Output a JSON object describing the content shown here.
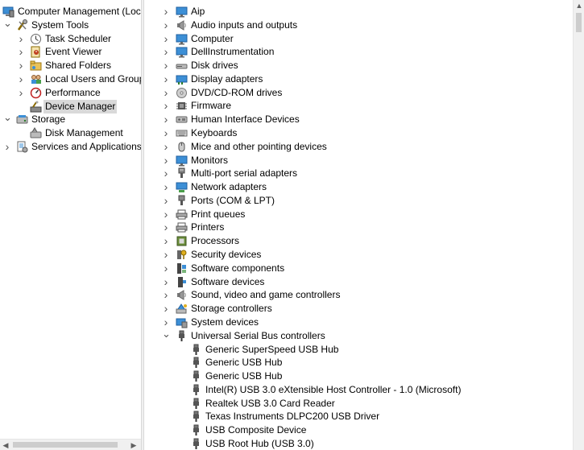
{
  "console_tree": {
    "items": [
      {
        "label": "Computer Management (Local",
        "icon": "computer-management-icon",
        "level": 0,
        "expander": ""
      },
      {
        "label": "System Tools",
        "icon": "system-tools-icon",
        "level": 1,
        "expander": "expanded"
      },
      {
        "label": "Task Scheduler",
        "icon": "clock-icon",
        "level": 2,
        "expander": "collapsed"
      },
      {
        "label": "Event Viewer",
        "icon": "event-viewer-icon",
        "level": 2,
        "expander": "collapsed"
      },
      {
        "label": "Shared Folders",
        "icon": "shared-folder-icon",
        "level": 2,
        "expander": "collapsed"
      },
      {
        "label": "Local Users and Groups",
        "icon": "users-icon",
        "level": 2,
        "expander": "collapsed"
      },
      {
        "label": "Performance",
        "icon": "performance-icon",
        "level": 2,
        "expander": "collapsed"
      },
      {
        "label": "Device Manager",
        "icon": "device-manager-icon",
        "level": 2,
        "expander": "",
        "selected": true
      },
      {
        "label": "Storage",
        "icon": "storage-icon",
        "level": 1,
        "expander": "expanded"
      },
      {
        "label": "Disk Management",
        "icon": "disk-management-icon",
        "level": 2,
        "expander": ""
      },
      {
        "label": "Services and Applications",
        "icon": "services-icon",
        "level": 1,
        "expander": "collapsed"
      }
    ]
  },
  "device_tree": {
    "categories": [
      {
        "label": "Aip",
        "icon": "monitor-icon"
      },
      {
        "label": "Audio inputs and outputs",
        "icon": "speaker-icon"
      },
      {
        "label": "Computer",
        "icon": "monitor-icon"
      },
      {
        "label": "DellInstrumentation",
        "icon": "monitor-icon"
      },
      {
        "label": "Disk drives",
        "icon": "disk-drive-icon"
      },
      {
        "label": "Display adapters",
        "icon": "display-adapter-icon"
      },
      {
        "label": "DVD/CD-ROM drives",
        "icon": "dvd-icon"
      },
      {
        "label": "Firmware",
        "icon": "firmware-icon"
      },
      {
        "label": "Human Interface Devices",
        "icon": "hid-icon"
      },
      {
        "label": "Keyboards",
        "icon": "keyboard-icon"
      },
      {
        "label": "Mice and other pointing devices",
        "icon": "mouse-icon"
      },
      {
        "label": "Monitors",
        "icon": "monitor-icon"
      },
      {
        "label": "Multi-port serial adapters",
        "icon": "serial-port-icon"
      },
      {
        "label": "Network adapters",
        "icon": "network-adapter-icon"
      },
      {
        "label": "Ports (COM & LPT)",
        "icon": "port-icon"
      },
      {
        "label": "Print queues",
        "icon": "printer-icon"
      },
      {
        "label": "Printers",
        "icon": "printer-icon"
      },
      {
        "label": "Processors",
        "icon": "processor-icon"
      },
      {
        "label": "Security devices",
        "icon": "security-key-icon"
      },
      {
        "label": "Software components",
        "icon": "software-component-icon"
      },
      {
        "label": "Software devices",
        "icon": "software-device-icon"
      },
      {
        "label": "Sound, video and game controllers",
        "icon": "speaker-icon"
      },
      {
        "label": "Storage controllers",
        "icon": "storage-controller-icon"
      },
      {
        "label": "System devices",
        "icon": "system-devices-icon"
      },
      {
        "label": "Universal Serial Bus controllers",
        "icon": "usb-icon",
        "expanded": true
      }
    ],
    "usb_children": [
      {
        "label": "Generic SuperSpeed USB Hub",
        "icon": "usb-icon"
      },
      {
        "label": "Generic USB Hub",
        "icon": "usb-icon"
      },
      {
        "label": "Generic USB Hub",
        "icon": "usb-icon"
      },
      {
        "label": "Intel(R) USB 3.0 eXtensible Host Controller - 1.0 (Microsoft)",
        "icon": "usb-icon"
      },
      {
        "label": "Realtek USB 3.0 Card Reader",
        "icon": "usb-icon"
      },
      {
        "label": "Texas Instruments DLPC200 USB Driver",
        "icon": "usb-icon"
      },
      {
        "label": "USB Composite Device",
        "icon": "usb-icon"
      },
      {
        "label": "USB Root Hub (USB 3.0)",
        "icon": "usb-icon"
      }
    ]
  },
  "colors": {
    "selection": "#d9d9d9",
    "monitor_blue": "#3c8fd6",
    "expander": "#555555"
  }
}
